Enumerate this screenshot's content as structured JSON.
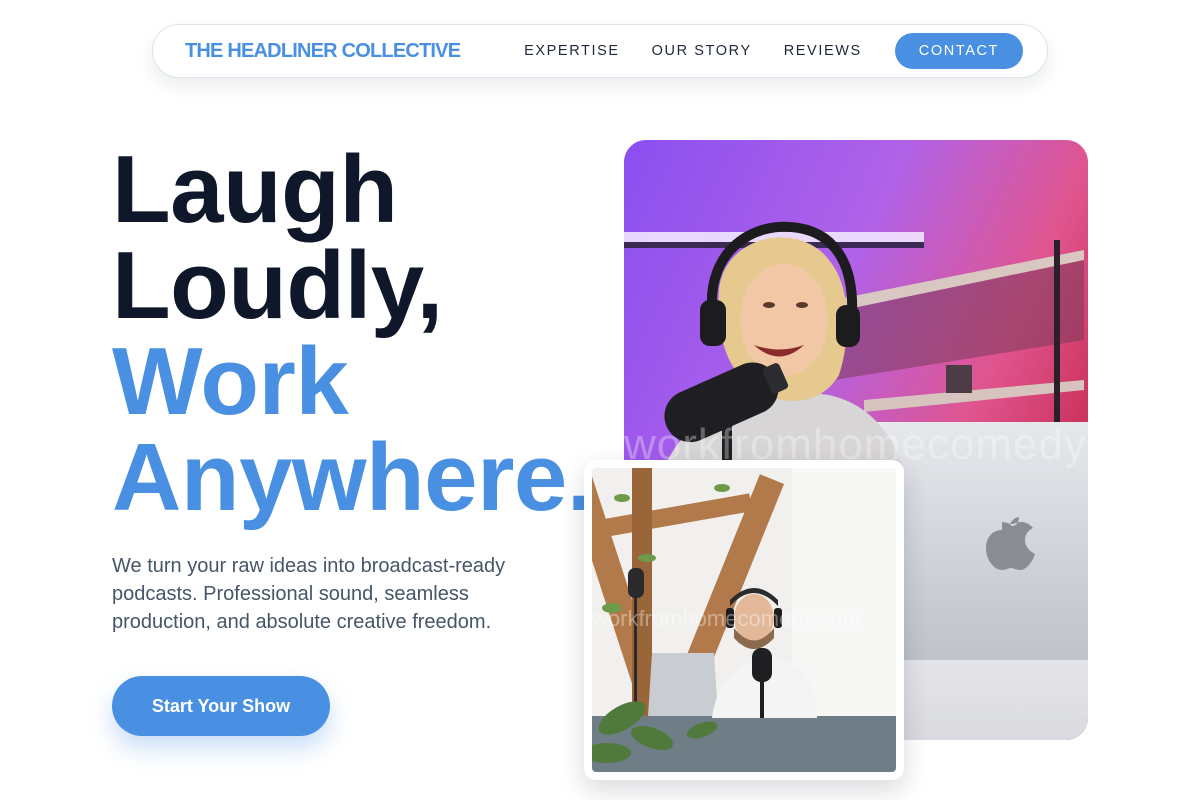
{
  "nav": {
    "brand": "THE HEADLINER COLLECTIVE",
    "links": [
      {
        "label": "EXPERTISE"
      },
      {
        "label": "OUR STORY"
      },
      {
        "label": "REVIEWS"
      }
    ],
    "contact_label": "CONTACT"
  },
  "hero": {
    "headline": {
      "line1": "Laugh",
      "line2": "Loudly,",
      "line3": "Work",
      "line4": "Anywhere."
    },
    "subtext": "We turn your raw ideas into broadcast-ready podcasts. Professional sound, seamless production, and absolute creative freedom.",
    "cta_label": "Start Your Show",
    "main_photo": {
      "alt": "Woman laughing into a podcast microphone",
      "watermark": "workfromhomecomedy.com"
    },
    "inset_photo": {
      "alt": "Man recording a podcast at a desk with plants",
      "watermark": "workfromhomecomedy.com"
    }
  },
  "colors": {
    "accent": "#4a90e2",
    "heading": "#0f172a",
    "body": "#475569"
  }
}
